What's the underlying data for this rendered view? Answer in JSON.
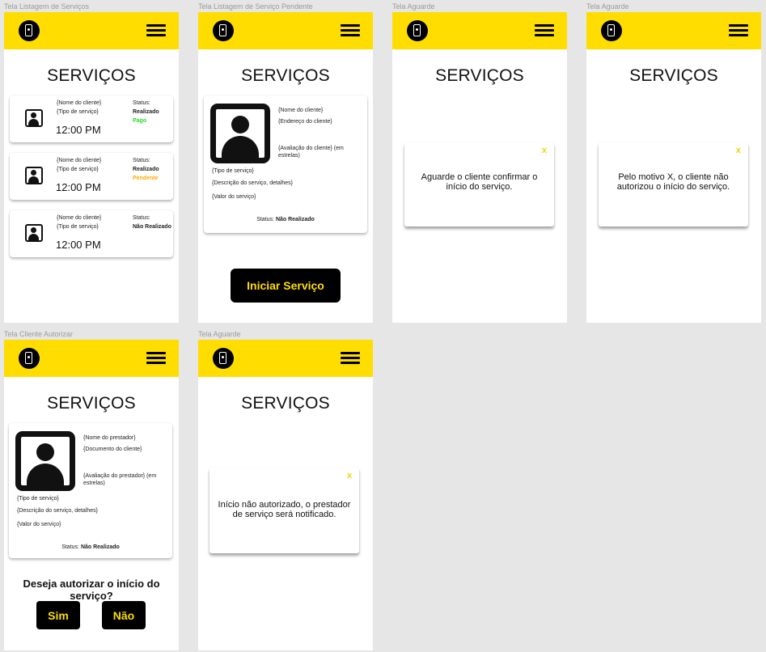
{
  "frames": {
    "list": {
      "label": "Tela Listagem de Serviços",
      "title": "SERVIÇOS",
      "items": [
        {
          "client": "{Nome do cliente}",
          "service": "{Tipo de serviço}",
          "time": "12:00 PM",
          "status_label": "Status:",
          "status": "Realizado",
          "payment": "Pago",
          "payment_color": "#22dd22"
        },
        {
          "client": "{Nome do cliente}",
          "service": "{Tipo de serviço}",
          "time": "12:00 PM",
          "status_label": "Status:",
          "status": "Realizado",
          "payment": "Pendente",
          "payment_color": "#ffaa00"
        },
        {
          "client": "{Nome do cliente}",
          "service": "{Tipo de serviço}",
          "time": "12:00 PM",
          "status_label": "Status:",
          "status": "Não Realizado"
        }
      ]
    },
    "pending": {
      "label": "Tela Listagem de Serviço Pendente",
      "title": "SERVIÇOS",
      "client_name": "{Nome do cliente}",
      "client_address": "{Endereço do cliente}",
      "client_rating": "{Avaliação do cliente} (em estrelas)",
      "service_type": "{Tipo de serviço}",
      "service_description": "{Descrição do serviço, detalhes}",
      "service_value": "{Valor do serviço}",
      "status_label": "Status:",
      "status_value": "Não Realizado",
      "start_button": "Iniciar Serviço"
    },
    "wait1": {
      "label": "Tela Aguarde",
      "title": "SERVIÇOS",
      "close": "x",
      "message": "Aguarde o cliente confirmar o início do serviço."
    },
    "wait2": {
      "label": "Tela Aguarde",
      "title": "SERVIÇOS",
      "close": "x",
      "message": "Pelo motivo X, o cliente não autorizou o início do serviço."
    },
    "authorize": {
      "label": "Tela Cliente Autorizar",
      "title": "SERVIÇOS",
      "provider_name": "{Nome do prestador}",
      "client_document": "{Documento do cliente}",
      "provider_rating": "{Avaliação do prestador} (em estrelas)",
      "service_type": "{Tipo de serviço}",
      "service_description": "{Descrição do serviço, detalhes}",
      "service_value": "{Valor do serviço}",
      "status_label": "Status:",
      "status_value": "Não Realizado",
      "question": "Deseja autorizar o início do serviço?",
      "yes": "Sim",
      "no": "Não"
    },
    "wait3": {
      "label": "Tela Aguarde",
      "title": "SERVIÇOS",
      "close": "x",
      "message": "Início não autorizado, o prestador de serviço será notificado."
    }
  },
  "colors": {
    "brand": "#ffdd00",
    "background": "#e6e6e6"
  }
}
